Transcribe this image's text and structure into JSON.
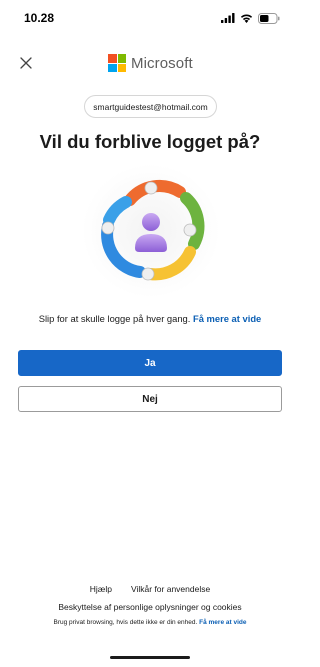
{
  "status_bar": {
    "time": "10.28",
    "icons": [
      "signal-icon",
      "wifi-icon",
      "battery-icon"
    ],
    "battery_level": 0.55
  },
  "header": {
    "close_icon": "close-icon",
    "brand_name": "Microsoft",
    "logo_colors": [
      "#f25022",
      "#7fba00",
      "#00a4ef",
      "#ffb900"
    ]
  },
  "account": {
    "email": "smartguidestest@hotmail.com"
  },
  "main": {
    "title": "Vil du forblive logget på?",
    "description": "Slip for at skulle logge på hver gang.",
    "learn_more": "Få mere at vide",
    "illustration": "sign-in-illustration"
  },
  "actions": {
    "yes_label": "Ja",
    "no_label": "Nej"
  },
  "footer": {
    "help": "Hjælp",
    "terms": "Vilkår for anvendelse",
    "privacy": "Beskyttelse af personlige oplysninger og cookies",
    "private_note": "Brug privat browsing, hvis dette ikke er din enhed.",
    "private_note_link": "Få mere at vide"
  },
  "colors": {
    "accent": "#1767c7",
    "link": "#0b5fb4",
    "text": "#1b1b1b"
  }
}
